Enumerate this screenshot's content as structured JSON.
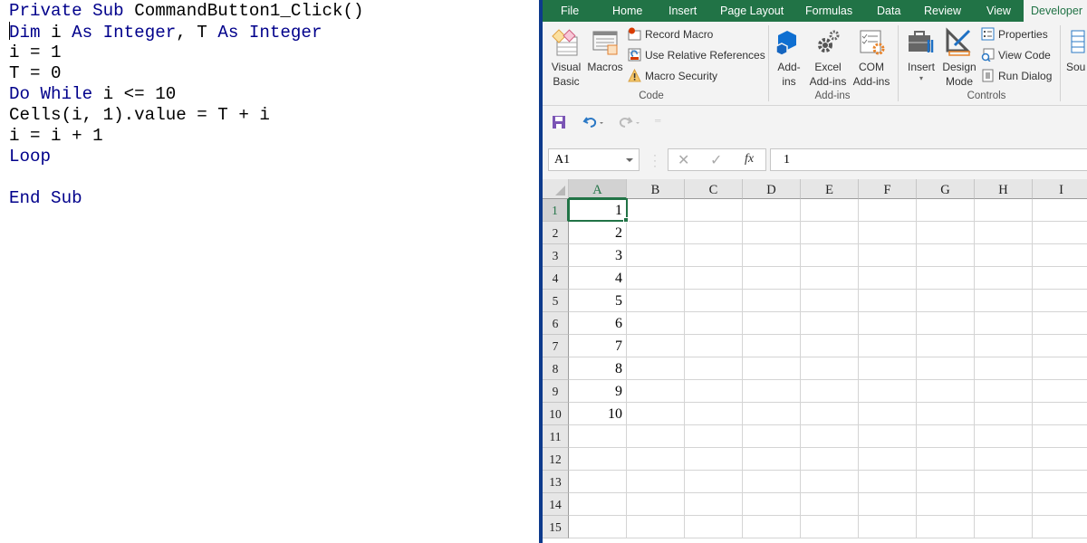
{
  "code_editor": {
    "lines": [
      [
        {
          "t": "Private Sub ",
          "k": true
        },
        {
          "t": "CommandButton1_Click()",
          "k": false
        }
      ],
      [
        {
          "t": "Dim ",
          "k": true
        },
        {
          "t": "i ",
          "k": false
        },
        {
          "t": "As Integer",
          "k": true
        },
        {
          "t": ", T ",
          "k": false
        },
        {
          "t": "As Integer",
          "k": true
        }
      ],
      [
        {
          "t": "i = 1",
          "k": false
        }
      ],
      [
        {
          "t": "T = 0",
          "k": false
        }
      ],
      [
        {
          "t": "Do While ",
          "k": true
        },
        {
          "t": "i <= 10",
          "k": false
        }
      ],
      [
        {
          "t": "Cells(i, 1).value = T + i",
          "k": false
        }
      ],
      [
        {
          "t": "i = i + 1",
          "k": false
        }
      ],
      [
        {
          "t": "Loop",
          "k": true
        }
      ],
      [
        {
          "t": "",
          "k": false
        }
      ],
      [
        {
          "t": "End Sub",
          "k": true
        }
      ]
    ],
    "colors": {
      "keyword": "#00008b",
      "text": "#000000"
    }
  },
  "excel": {
    "tabs": [
      "File",
      "Home",
      "Insert",
      "Page Layout",
      "Formulas",
      "Data",
      "Review",
      "View",
      "Developer"
    ],
    "active_tab": "Developer",
    "brand_color": "#217346",
    "ribbon": {
      "code": {
        "label": "Code",
        "visual_basic": "Visual Basic",
        "macros": "Macros",
        "record_macro": "Record Macro",
        "use_relative_references": "Use Relative References",
        "macro_security": "Macro Security"
      },
      "addins": {
        "label": "Add-ins",
        "addins": "Add-ins",
        "excel_addins": "Excel Add-ins",
        "com_addins": "COM Add-ins"
      },
      "controls": {
        "label": "Controls",
        "insert": "Insert",
        "design_mode": "Design Mode",
        "properties": "Properties",
        "view_code": "View Code",
        "run_dialog": "Run Dialog"
      },
      "xml": {
        "source_partial": "Sou"
      }
    },
    "name_box": "A1",
    "formula_value": "1",
    "fx_label": "fx",
    "columns": [
      "A",
      "B",
      "C",
      "D",
      "E",
      "F",
      "G",
      "H",
      "I"
    ],
    "selected_column": "A",
    "rows": [
      "1",
      "2",
      "3",
      "4",
      "5",
      "6",
      "7",
      "8",
      "9",
      "10",
      "11",
      "12",
      "13",
      "14",
      "15"
    ],
    "selected_row": "1",
    "column_a_values": [
      "1",
      "2",
      "3",
      "4",
      "5",
      "6",
      "7",
      "8",
      "9",
      "10",
      "",
      "",
      "",
      "",
      ""
    ]
  }
}
